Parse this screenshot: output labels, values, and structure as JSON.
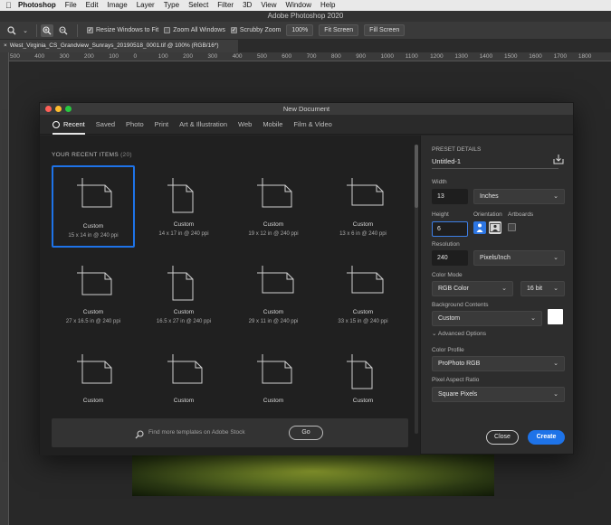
{
  "menubar": {
    "apple": "",
    "items": [
      "Photoshop",
      "File",
      "Edit",
      "Image",
      "Layer",
      "Type",
      "Select",
      "Filter",
      "3D",
      "View",
      "Window",
      "Help"
    ]
  },
  "window_title": "Adobe Photoshop 2020",
  "options": {
    "resize_windows": "Resize Windows to Fit",
    "zoom_all": "Zoom All Windows",
    "scrubby_zoom": "Scrubby Zoom",
    "zoom_pct": "100%",
    "fit_screen": "Fit Screen",
    "fill_screen": "Fill Screen"
  },
  "doc_tab": "West_Virginia_CS_Grandview_Sunrays_20190518_0001.tif @ 100% (RGB/16*)",
  "ruler": {
    "ticks": [
      "500",
      "400",
      "300",
      "200",
      "100",
      "0",
      "100",
      "200",
      "300",
      "400",
      "500",
      "600",
      "700",
      "800",
      "900",
      "1000",
      "1100",
      "1200",
      "1300",
      "1400",
      "1500",
      "1600",
      "1700",
      "1800"
    ]
  },
  "dialog": {
    "title": "New Document",
    "tabs": [
      "Recent",
      "Saved",
      "Photo",
      "Print",
      "Art & Illustration",
      "Web",
      "Mobile",
      "Film & Video"
    ],
    "recent_heading": "YOUR RECENT ITEMS",
    "recent_count": "(20)",
    "items": [
      {
        "name": "Custom",
        "size": "15 x 14 in @ 240 ppi",
        "shape": "landscape"
      },
      {
        "name": "Custom",
        "size": "14 x 17 in @ 240 ppi",
        "shape": "portrait"
      },
      {
        "name": "Custom",
        "size": "19 x 12 in @ 240 ppi",
        "shape": "landscape"
      },
      {
        "name": "Custom",
        "size": "13 x 6 in @ 240 ppi",
        "shape": "wide"
      },
      {
        "name": "Custom",
        "size": "27 x 16.5 in @ 240 ppi",
        "shape": "landscape"
      },
      {
        "name": "Custom",
        "size": "16.5 x 27 in @ 240 ppi",
        "shape": "portrait"
      },
      {
        "name": "Custom",
        "size": "29 x 11 in @ 240 ppi",
        "shape": "wide"
      },
      {
        "name": "Custom",
        "size": "33 x 15 in @ 240 ppi",
        "shape": "wide"
      },
      {
        "name": "Custom",
        "size": "",
        "shape": "landscape"
      },
      {
        "name": "Custom",
        "size": "",
        "shape": "landscape"
      },
      {
        "name": "Custom",
        "size": "",
        "shape": "landscape"
      },
      {
        "name": "Custom",
        "size": "",
        "shape": "portrait"
      }
    ],
    "search_placeholder": "Find more templates on Adobe Stock",
    "go_label": "Go",
    "preset": {
      "heading": "PRESET DETAILS",
      "doc_name": "Untitled-1",
      "width_label": "Width",
      "width_value": "13",
      "width_unit": "Inches",
      "height_label": "Height",
      "height_value": "6",
      "orientation_label": "Orientation",
      "artboards_label": "Artboards",
      "resolution_label": "Resolution",
      "resolution_value": "240",
      "resolution_unit": "Pixels/Inch",
      "color_mode_label": "Color Mode",
      "color_mode": "RGB Color",
      "bit_depth": "16 bit",
      "background_label": "Background Contents",
      "background": "Custom",
      "advanced_label": "Advanced Options",
      "profile_label": "Color Profile",
      "profile": "ProPhoto RGB",
      "aspect_label": "Pixel Aspect Ratio",
      "aspect": "Square Pixels",
      "close_label": "Close",
      "create_label": "Create"
    }
  },
  "colors": {
    "accent": "#1e73e8",
    "dialog_bg": "#252525",
    "app_bg": "#282828"
  }
}
